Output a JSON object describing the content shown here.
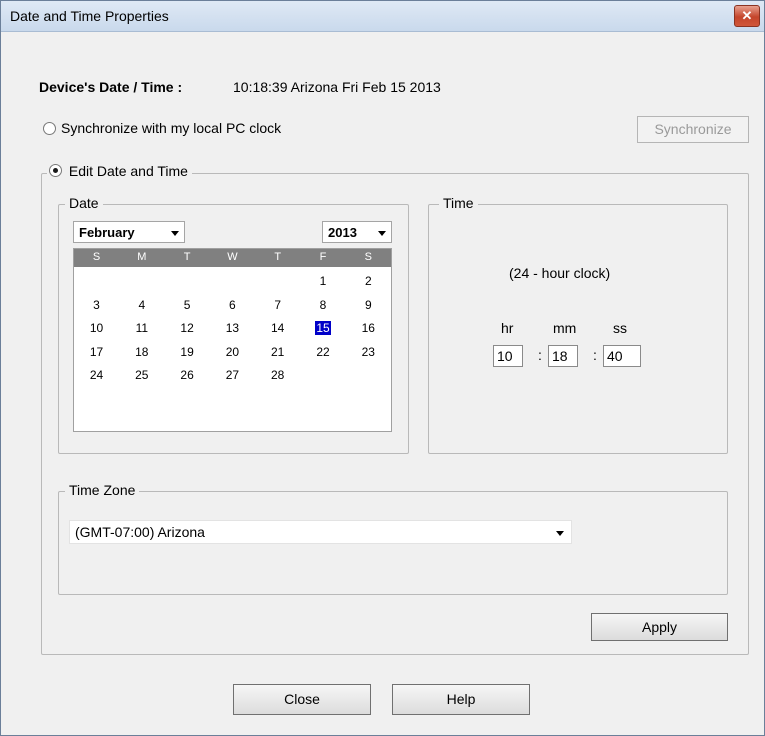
{
  "window": {
    "title": "Date and Time Properties",
    "close_glyph": "✕"
  },
  "device": {
    "label": "Device's Date / Time :",
    "value": "10:18:39 Arizona Fri Feb 15 2013"
  },
  "sync": {
    "radio_label": "Synchronize with my local PC clock",
    "button": "Synchronize",
    "selected": false
  },
  "edit": {
    "radio_label": "Edit Date and Time",
    "selected": true
  },
  "date": {
    "legend": "Date",
    "month": "February",
    "year": "2013",
    "weekdays": [
      "S",
      "M",
      "T",
      "W",
      "T",
      "F",
      "S"
    ],
    "weeks": [
      [
        "",
        "",
        "",
        "",
        "",
        "1",
        "2"
      ],
      [
        "3",
        "4",
        "5",
        "6",
        "7",
        "8",
        "9"
      ],
      [
        "10",
        "11",
        "12",
        "13",
        "14",
        "15",
        "16"
      ],
      [
        "17",
        "18",
        "19",
        "20",
        "21",
        "22",
        "23"
      ],
      [
        "24",
        "25",
        "26",
        "27",
        "28",
        "",
        ""
      ]
    ],
    "selected_day": "15"
  },
  "time": {
    "legend": "Time",
    "caption": "(24 - hour clock)",
    "labels": {
      "hr": "hr",
      "mm": "mm",
      "ss": "ss"
    },
    "values": {
      "hr": "10",
      "mm": "18",
      "ss": "40"
    },
    "separator": ":"
  },
  "timezone": {
    "legend": "Time Zone",
    "value": "(GMT-07:00) Arizona"
  },
  "buttons": {
    "apply": "Apply",
    "close": "Close",
    "help": "Help"
  },
  "colors": {
    "selected_day": "#0000c8",
    "calendar_header": "#808080",
    "close_button": "#c4452b"
  }
}
